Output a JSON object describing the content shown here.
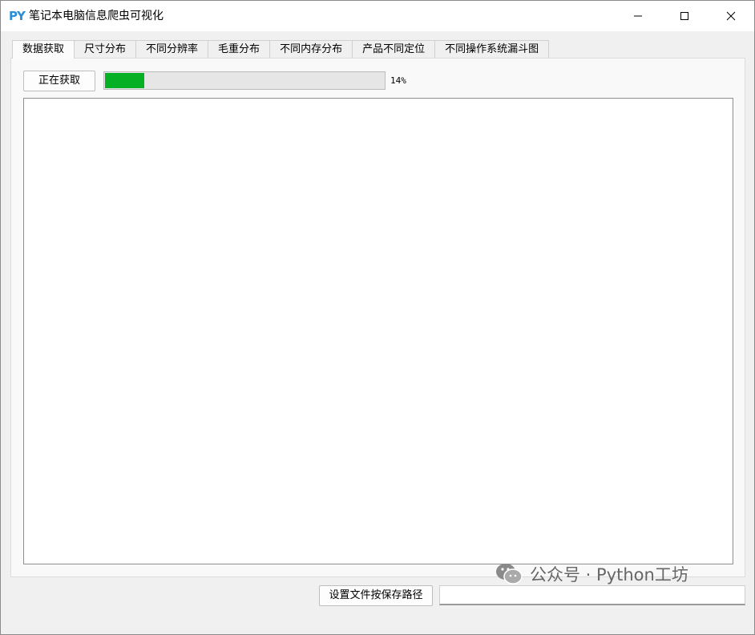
{
  "window": {
    "icon_text": "PY",
    "title": "笔记本电脑信息爬虫可视化",
    "minimize_icon": "minimize-icon",
    "maximize_icon": "maximize-icon",
    "close_icon": "close-icon"
  },
  "tabs": [
    {
      "label": "数据获取",
      "active": true
    },
    {
      "label": "尺寸分布",
      "active": false
    },
    {
      "label": "不同分辨率",
      "active": false
    },
    {
      "label": "毛重分布",
      "active": false
    },
    {
      "label": "不同内存分布",
      "active": false
    },
    {
      "label": "产品不同定位",
      "active": false
    },
    {
      "label": "不同操作系统漏斗图",
      "active": false
    }
  ],
  "fetch": {
    "button_label": "正在获取",
    "progress_value": 0.14,
    "progress_text": "14%",
    "progress_color": "#06b025",
    "log_text": ""
  },
  "footer": {
    "path_button_label": "设置文件按保存路径",
    "path_value": ""
  },
  "watermark": {
    "icon": "wechat-icon",
    "text": "公众号 · Python工坊"
  }
}
